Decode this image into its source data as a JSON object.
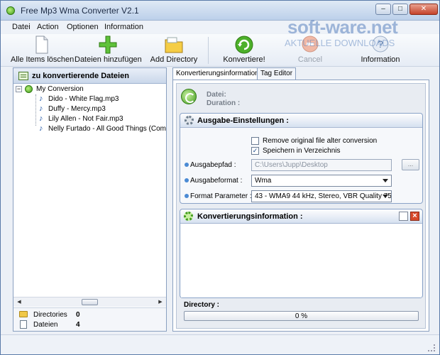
{
  "window": {
    "title": "Free Mp3 Wma Converter V2.1",
    "minimize": "–",
    "maximize": "□",
    "close": "✕"
  },
  "watermark": {
    "main": "soft-ware.net",
    "sub": "AKTUELLE DOWNLOADS"
  },
  "menu": [
    "Datei",
    "Action",
    "Optionen",
    "Information"
  ],
  "toolbar": {
    "clear": "Alle Items löschen",
    "add_files": "Dateien hinzufügen",
    "add_dir": "Add Directory",
    "convert": "Konvertiere!",
    "cancel": "Cancel",
    "info": "Information"
  },
  "left_panel": {
    "header": "zu konvertierende Dateien",
    "root": "My Conversion",
    "files": [
      "Dido - White Flag.mp3",
      "Duffy - Mercy.mp3",
      "Lily Allen - Not Fair.mp3",
      "Nelly Furtado - All Good Things (Come To"
    ],
    "stats": {
      "directories_label": "Directories",
      "directories_value": "0",
      "files_label": "Dateien",
      "files_value": "4"
    }
  },
  "tabs": [
    "Konvertierungsinformation :",
    "Tag Editor"
  ],
  "file_info": {
    "file_label": "Datei:",
    "duration_label": "Duration :"
  },
  "output_settings": {
    "header": "Ausgabe-Einstellungen :",
    "remove_original": "Remove original file alter conversion",
    "remove_checked": false,
    "save_in_dir": "Speichern in Verzeichnis",
    "save_checked": true,
    "path_label": "Ausgabepfad :",
    "path_value": "C:\\Users\\Jupp\\Desktop",
    "browse": "...",
    "format_label": "Ausgabeformat :",
    "format_value": "Wma",
    "params_label": "Format Parameter :",
    "params_value": "43 - WMA9  44 kHz, Stereo, VBR Quality 75"
  },
  "conversion_info": {
    "header": "Konvertierungsinformation :"
  },
  "progress": {
    "dir_label": "Directory :",
    "value": 0,
    "text": "0 %"
  },
  "colors": {
    "accent": "#3f9a1c",
    "frame": "#8aa0c0"
  }
}
